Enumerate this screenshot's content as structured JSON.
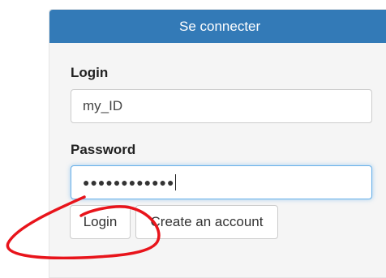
{
  "panel": {
    "title": "Se connecter"
  },
  "form": {
    "login_label": "Login",
    "login_value": "my_ID",
    "password_label": "Password",
    "password_mask": "●●●●●●●●●●●●"
  },
  "buttons": {
    "login": "Login",
    "create_account": "Create an account"
  },
  "colors": {
    "header": "#337ab7",
    "annotation": "#e8141b",
    "focus_border": "#66afe9"
  }
}
